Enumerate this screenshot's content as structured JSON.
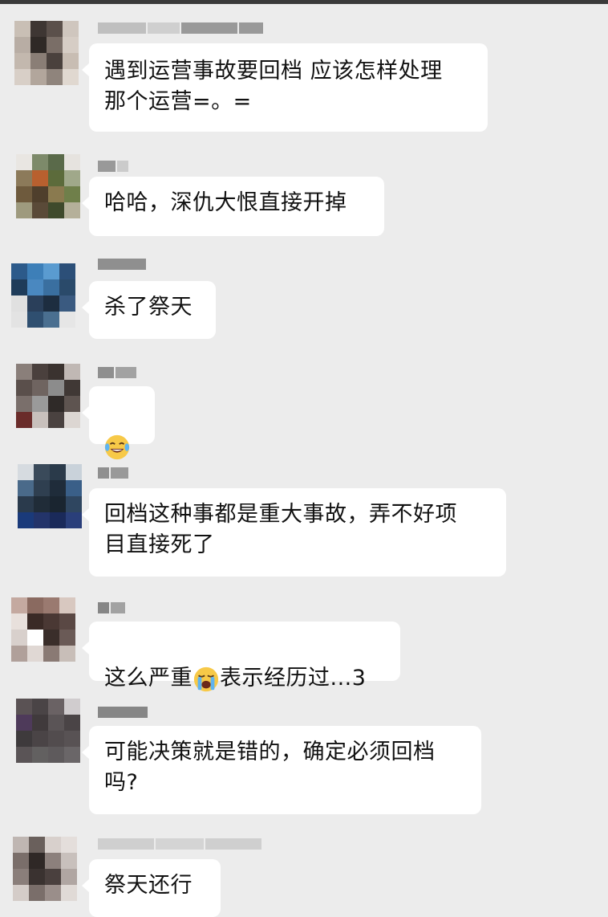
{
  "chat": {
    "messages": [
      {
        "sender": "",
        "text": "遇到运营事故要回档 应该怎样处理\n那个运营=。="
      },
      {
        "sender": "",
        "text": "哈哈，深仇大恨直接开掉"
      },
      {
        "sender": "",
        "text": "杀了祭天"
      },
      {
        "sender": "",
        "emoji": "laughing-crying-emoji"
      },
      {
        "sender": "",
        "text": "回档这种事都是重大事故，弄不好项\n目直接死了"
      },
      {
        "sender": "",
        "text_before": "这么严重",
        "emoji": "loudly-crying-emoji",
        "text_after": "表示经历过...3"
      },
      {
        "sender": "",
        "text": "可能决策就是错的，确定必须回档\n吗?"
      },
      {
        "sender": "",
        "text": "祭天还行"
      }
    ]
  },
  "colors": {
    "background": "#ececec",
    "bubble": "#ffffff",
    "text": "#111111",
    "emoji_face": "#f7c948"
  }
}
